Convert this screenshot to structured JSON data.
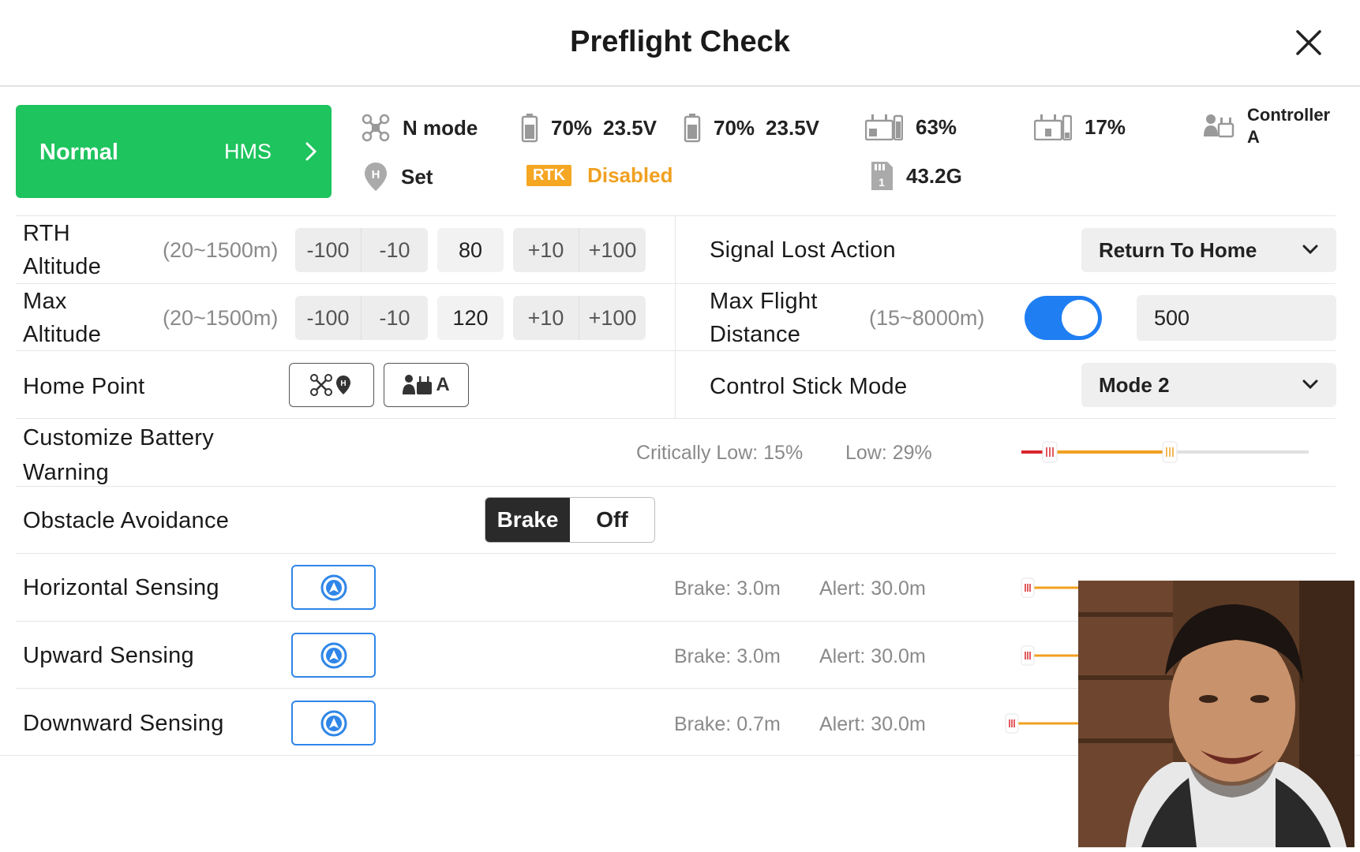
{
  "header": {
    "title": "Preflight Check"
  },
  "status": {
    "state": "Normal",
    "hms_label": "HMS",
    "color": "#1ec45e"
  },
  "telemetry": {
    "flight_mode": "N mode",
    "aircraft_battery_pct": "70%",
    "aircraft_battery_voltage": "23.5V",
    "aircraft_battery2_pct": "70%",
    "aircraft_battery2_voltage": "23.5V",
    "rc_signal_pct": "63%",
    "rc_battery_pct": "17%",
    "controller_label_line1": "Controller",
    "controller_label_line2": "A",
    "home_point": "Set",
    "rtk_badge": "RTK",
    "rtk_status": "Disabled",
    "storage": "43.2G"
  },
  "rth_altitude": {
    "label_line1": "RTH",
    "label_line2": "Altitude",
    "range": "(20~1500m)",
    "minus100": "-100",
    "minus10": "-10",
    "value": "80",
    "plus10": "+10",
    "plus100": "+100"
  },
  "max_altitude": {
    "label_line1": "Max",
    "label_line2": "Altitude",
    "range": "(20~1500m)",
    "minus100": "-100",
    "minus10": "-10",
    "value": "120",
    "plus10": "+10",
    "plus100": "+100"
  },
  "signal_lost": {
    "label": "Signal Lost Action",
    "value": "Return To Home"
  },
  "max_distance": {
    "label_line1": "Max Flight",
    "label_line2": "Distance",
    "range": "(15~8000m)",
    "enabled": true,
    "value": "500"
  },
  "home_point": {
    "label": "Home Point",
    "aircraft_btn_icon": "drone-home-icon",
    "rc_btn_text": "A"
  },
  "stick_mode": {
    "label": "Control Stick Mode",
    "value": "Mode 2"
  },
  "battery_warning": {
    "label_line1": "Customize Battery",
    "label_line2": "Warning",
    "critical_text": "Critically Low: 15%",
    "low_text": "Low: 29%",
    "critical_pct": 15,
    "low_pct": 29
  },
  "obstacle": {
    "label": "Obstacle Avoidance",
    "brake": "Brake",
    "off": "Off",
    "selected": "Brake"
  },
  "sensing": [
    {
      "label": "Horizontal Sensing",
      "brake": "Brake: 3.0m",
      "alert": "Alert: 30.0m"
    },
    {
      "label": "Upward Sensing",
      "brake": "Brake: 3.0m",
      "alert": "Alert: 30.0m"
    },
    {
      "label": "Downward Sensing",
      "brake": "Brake: 0.7m",
      "alert": "Alert: 30.0m"
    }
  ],
  "colors": {
    "accent": "#1f7ef2",
    "ok": "#1ec45e",
    "warn": "#f0a020",
    "critical": "#d9262c"
  }
}
